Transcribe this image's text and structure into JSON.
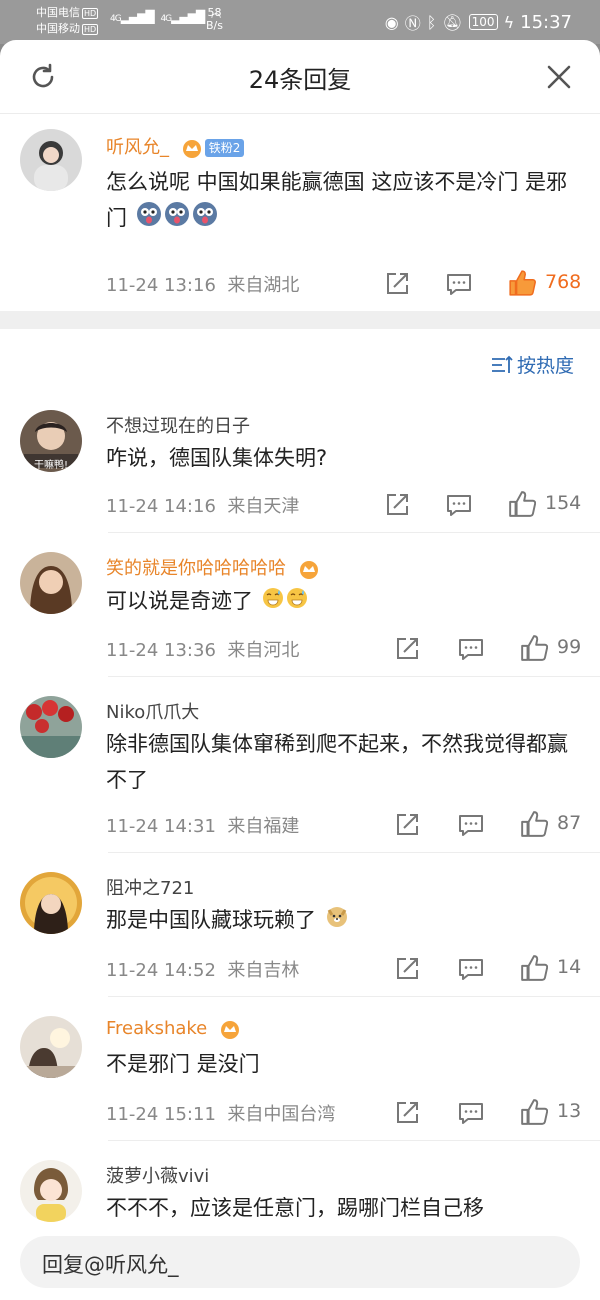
{
  "status_bar": {
    "carrier1": "中国电信",
    "carrier2": "中国移动",
    "hd": "HD",
    "signal1": "4G",
    "signal2": "4G",
    "speed_value": "58",
    "speed_unit": "B/s",
    "battery": "100",
    "time": "15:37"
  },
  "header": {
    "title": "24条回复"
  },
  "main_comment": {
    "username": "听风允_",
    "fan_badge": "铁粉2",
    "text": "怎么说呢 中国如果能赢德国 这应该不是冷门 是邪门",
    "time": "11-24 13:16",
    "location": "来自湖北",
    "likes": "768"
  },
  "sort": {
    "label": "按热度"
  },
  "replies": [
    {
      "username": "不想过现在的日子",
      "text": "咋说，德国队集体失明?",
      "time": "11-24 14:16",
      "location": "来自天津",
      "likes": "154",
      "avatar_caption": "干嘛鸭!"
    },
    {
      "username": "笑的就是你哈哈哈哈哈",
      "text": "可以说是奇迹了",
      "time": "11-24 13:36",
      "location": "来自河北",
      "likes": "99"
    },
    {
      "username": "Niko爪爪大",
      "text": "除非德国队集体窜稀到爬不起来，不然我觉得都赢不了",
      "time": "11-24 14:31",
      "location": "来自福建",
      "likes": "87"
    },
    {
      "username": "阻冲之721",
      "text": "那是中国队藏球玩赖了",
      "time": "11-24 14:52",
      "location": "来自吉林",
      "likes": "14"
    },
    {
      "username": "Freakshake",
      "text": "不是邪门 是没门",
      "time": "11-24 15:11",
      "location": "来自中国台湾",
      "likes": "13"
    },
    {
      "username": "菠萝小薇vivi",
      "text": "不不不，应该是任意门，踢哪门栏自己移"
    }
  ],
  "reply_bar": {
    "placeholder": "回复@听风允_"
  },
  "colors": {
    "vip_name": "#e8852a",
    "like_active": "#f06c1e",
    "link_blue": "#2f6bb3"
  }
}
